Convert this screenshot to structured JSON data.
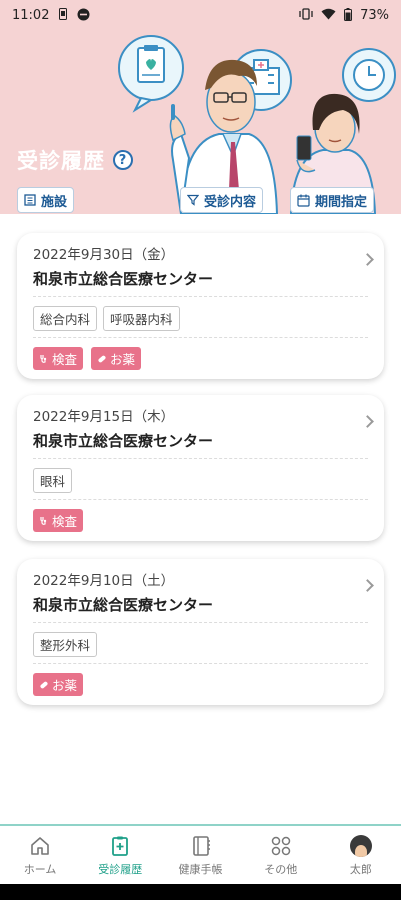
{
  "status_bar": {
    "time": "11:02",
    "battery": "73%",
    "icons": [
      "sim-icon",
      "dnd-icon",
      "vibrate-icon",
      "wifi-icon",
      "battery-icon"
    ]
  },
  "header": {
    "title": "受診履歴",
    "help_icon": "help-icon",
    "background_color": "#f5d3d3"
  },
  "filters": [
    {
      "label": "施設",
      "icon": "facility-icon"
    },
    {
      "label": "受診内容",
      "icon": "filter-icon"
    },
    {
      "label": "期間指定",
      "icon": "calendar-icon"
    }
  ],
  "visits": [
    {
      "date": "2022年9月30日（金）",
      "hospital": "和泉市立総合医療センター",
      "departments": [
        "総合内科",
        "呼吸器内科"
      ],
      "tags": [
        "検査",
        "お薬"
      ]
    },
    {
      "date": "2022年9月15日（木）",
      "hospital": "和泉市立総合医療センター",
      "departments": [
        "眼科"
      ],
      "tags": [
        "検査"
      ]
    },
    {
      "date": "2022年9月10日（土）",
      "hospital": "和泉市立総合医療センター",
      "departments": [
        "整形外科"
      ],
      "tags": [
        "お薬"
      ]
    }
  ],
  "bottom_nav": [
    {
      "label": "ホーム",
      "icon": "home-icon",
      "active": false
    },
    {
      "label": "受診履歴",
      "icon": "clipboard-icon",
      "active": true
    },
    {
      "label": "健康手帳",
      "icon": "notebook-icon",
      "active": false
    },
    {
      "label": "その他",
      "icon": "grid-icon",
      "active": false
    },
    {
      "label": "太郎",
      "icon": "avatar",
      "active": false
    }
  ],
  "colors": {
    "accent_teal": "#1fa089",
    "tag_pink": "#e8728a",
    "link_blue": "#1d5a94"
  }
}
